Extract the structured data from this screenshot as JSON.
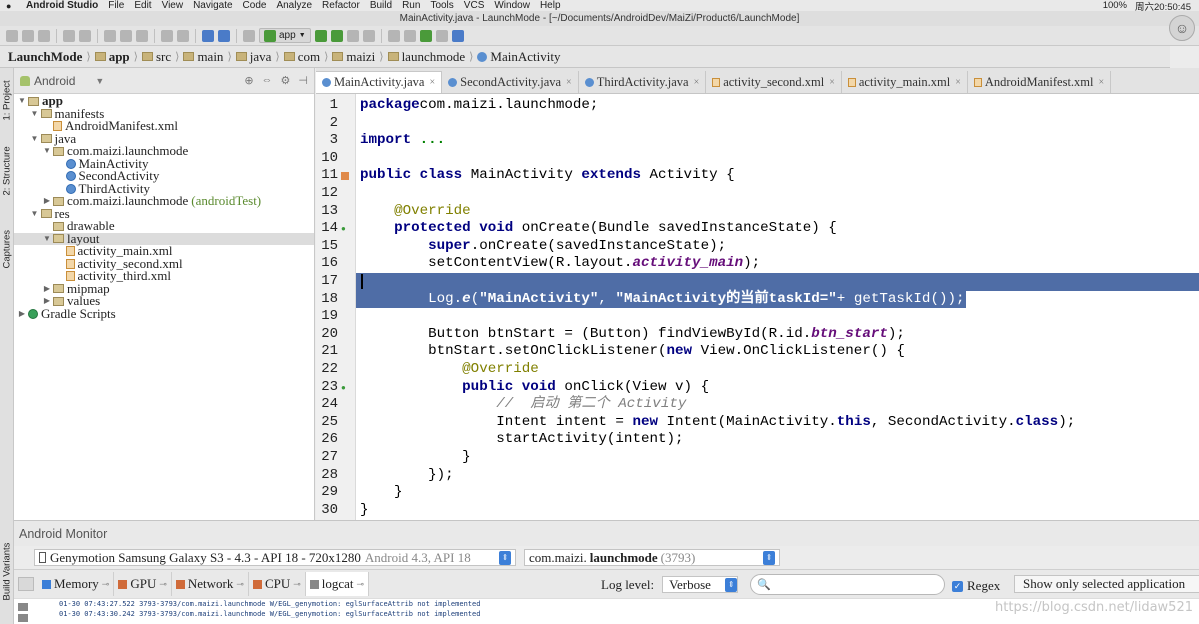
{
  "menubar": {
    "app_name": "Android Studio",
    "items": [
      "File",
      "Edit",
      "View",
      "Navigate",
      "Code",
      "Analyze",
      "Refactor",
      "Build",
      "Run",
      "Tools",
      "VCS",
      "Window",
      "Help"
    ],
    "battery": "100%",
    "clock": "周六20:50:45"
  },
  "window_title": "MainActivity.java - LaunchMode - [~/Documents/AndroidDev/MaiZi/Product6/LaunchMode]",
  "toolbar": {
    "run_config": "app"
  },
  "breadcrumb": [
    "LaunchMode",
    "app",
    "src",
    "main",
    "java",
    "com",
    "maizi",
    "launchmode",
    "MainActivity"
  ],
  "side_tabs": {
    "project": "1: Project",
    "structure": "2: Structure",
    "captures": "Captures",
    "build_variants": "Build Variants"
  },
  "project_panel": {
    "view_mode": "Android",
    "tree": [
      {
        "level": 0,
        "label": "app",
        "icon": "folder",
        "toggle": "open",
        "bold": true
      },
      {
        "level": 1,
        "label": "manifests",
        "icon": "folder",
        "toggle": "open"
      },
      {
        "level": 2,
        "label": "AndroidManifest.xml",
        "icon": "xml"
      },
      {
        "level": 1,
        "label": "java",
        "icon": "folder",
        "toggle": "open"
      },
      {
        "level": 2,
        "label": "com.maizi.launchmode",
        "icon": "pkg",
        "toggle": "open"
      },
      {
        "level": 3,
        "label": "MainActivity",
        "icon": "cls"
      },
      {
        "level": 3,
        "label": "SecondActivity",
        "icon": "cls"
      },
      {
        "level": 3,
        "label": "ThirdActivity",
        "icon": "cls"
      },
      {
        "level": 2,
        "label": "com.maizi.launchmode",
        "icon": "pkg",
        "toggle": "closed",
        "suffix": "(androidTest)"
      },
      {
        "level": 1,
        "label": "res",
        "icon": "folder",
        "toggle": "open"
      },
      {
        "level": 2,
        "label": "drawable",
        "icon": "folder"
      },
      {
        "level": 2,
        "label": "layout",
        "icon": "folder",
        "toggle": "open",
        "selected": true
      },
      {
        "level": 3,
        "label": "activity_main.xml",
        "icon": "xml"
      },
      {
        "level": 3,
        "label": "activity_second.xml",
        "icon": "xml"
      },
      {
        "level": 3,
        "label": "activity_third.xml",
        "icon": "xml"
      },
      {
        "level": 2,
        "label": "mipmap",
        "icon": "folder",
        "toggle": "closed"
      },
      {
        "level": 2,
        "label": "values",
        "icon": "folder",
        "toggle": "closed"
      },
      {
        "level": 0,
        "label": "Gradle Scripts",
        "icon": "gradle",
        "toggle": "closed"
      }
    ]
  },
  "editor_tabs": [
    {
      "label": "MainActivity.java",
      "icon": "class",
      "active": true
    },
    {
      "label": "SecondActivity.java",
      "icon": "class"
    },
    {
      "label": "ThirdActivity.java",
      "icon": "class"
    },
    {
      "label": "activity_second.xml",
      "icon": "xml"
    },
    {
      "label": "activity_main.xml",
      "icon": "xml"
    },
    {
      "label": "AndroidManifest.xml",
      "icon": "xml"
    }
  ],
  "code_lines": [
    {
      "n": "1",
      "tokens": [
        [
          "kw",
          "package"
        ],
        [
          "",
          "com.maizi.launchmode;"
        ]
      ]
    },
    {
      "n": "2",
      "tokens": []
    },
    {
      "n": "3",
      "tokens": [
        [
          "kw",
          "import"
        ],
        [
          "",
          " "
        ],
        [
          "str",
          "..."
        ]
      ]
    },
    {
      "n": "10",
      "tokens": []
    },
    {
      "n": "11",
      "mark": "class",
      "tokens": [
        [
          "kw",
          "public class "
        ],
        [
          "",
          "MainActivity "
        ],
        [
          "kw",
          "extends "
        ],
        [
          "",
          "Activity {"
        ]
      ]
    },
    {
      "n": "12",
      "tokens": []
    },
    {
      "n": "13",
      "tokens": [
        [
          "",
          "    "
        ],
        [
          "ann",
          "@Override"
        ]
      ]
    },
    {
      "n": "14",
      "mark": "override",
      "tokens": [
        [
          "",
          "    "
        ],
        [
          "kw",
          "protected void "
        ],
        [
          "",
          "onCreate(Bundle savedInstanceState) {"
        ]
      ]
    },
    {
      "n": "15",
      "tokens": [
        [
          "",
          "        "
        ],
        [
          "kw",
          "super"
        ],
        [
          "",
          ".onCreate(savedInstanceState);"
        ]
      ]
    },
    {
      "n": "16",
      "tokens": [
        [
          "",
          "        setContentView(R.layout."
        ],
        [
          "ital",
          "activity_main"
        ],
        [
          "",
          ");"
        ]
      ]
    },
    {
      "n": "17",
      "selected": true,
      "tokens": []
    },
    {
      "n": "18",
      "selected": true,
      "tokens": [
        [
          "",
          "        Log."
        ],
        [
          "ital",
          "e"
        ],
        [
          "",
          "("
        ],
        [
          "str",
          "\"MainActivity\""
        ],
        [
          "",
          ", "
        ],
        [
          "str",
          "\"MainActivity的当前taskId=\""
        ],
        [
          "",
          "+ getTaskId());"
        ]
      ]
    },
    {
      "n": "19",
      "tokens": []
    },
    {
      "n": "20",
      "tokens": [
        [
          "",
          "        Button btnStart = (Button) findViewById(R.id."
        ],
        [
          "ital",
          "btn_start"
        ],
        [
          "",
          ");"
        ]
      ]
    },
    {
      "n": "21",
      "tokens": [
        [
          "",
          "        btnStart.setOnClickListener("
        ],
        [
          "kw",
          "new "
        ],
        [
          "",
          "View.OnClickListener() {"
        ]
      ]
    },
    {
      "n": "22",
      "tokens": [
        [
          "",
          "            "
        ],
        [
          "ann",
          "@Override"
        ]
      ]
    },
    {
      "n": "23",
      "mark": "override",
      "tokens": [
        [
          "",
          "            "
        ],
        [
          "kw",
          "public void "
        ],
        [
          "",
          "onClick(View v) {"
        ]
      ]
    },
    {
      "n": "24",
      "tokens": [
        [
          "",
          "                "
        ],
        [
          "cmt",
          "//  启动 第二个 Activity"
        ]
      ]
    },
    {
      "n": "25",
      "tokens": [
        [
          "",
          "                Intent intent = "
        ],
        [
          "kw",
          "new "
        ],
        [
          "",
          "Intent(MainActivity."
        ],
        [
          "kw",
          "this"
        ],
        [
          "",
          ", SecondActivity."
        ],
        [
          "kw",
          "class"
        ],
        [
          "",
          ");"
        ]
      ]
    },
    {
      "n": "26",
      "tokens": [
        [
          "",
          "                startActivity(intent);"
        ]
      ]
    },
    {
      "n": "27",
      "tokens": [
        [
          "",
          "            }"
        ]
      ]
    },
    {
      "n": "28",
      "tokens": [
        [
          "",
          "        });"
        ]
      ]
    },
    {
      "n": "29",
      "tokens": [
        [
          "",
          "    }"
        ]
      ]
    },
    {
      "n": "30",
      "tokens": [
        [
          "",
          "}"
        ]
      ]
    }
  ],
  "monitor": {
    "title": "Android Monitor",
    "device": "Genymotion Samsung Galaxy S3 - 4.3 - API 18 - 720x1280",
    "device_sub": "Android 4.3, API 18",
    "process_prefix": "com.maizi.",
    "process_bold": "launchmode",
    "process_pid": "(3793)",
    "tabs": [
      "Memory",
      "GPU",
      "Network",
      "CPU",
      "logcat"
    ],
    "log_level_label": "Log level:",
    "log_level": "Verbose",
    "regex_label": "Regex",
    "filter": "Show only selected application",
    "log_lines": [
      "01-30 07:43:27.522 3793-3793/com.maizi.launchmode W/EGL_genymotion: eglSurfaceAttrib not implemented",
      "01-30 07:43:30.242 3793-3793/com.maizi.launchmode W/EGL_genymotion: eglSurfaceAttrib not implemented"
    ]
  },
  "watermark": "https://blog.csdn.net/lidaw521"
}
